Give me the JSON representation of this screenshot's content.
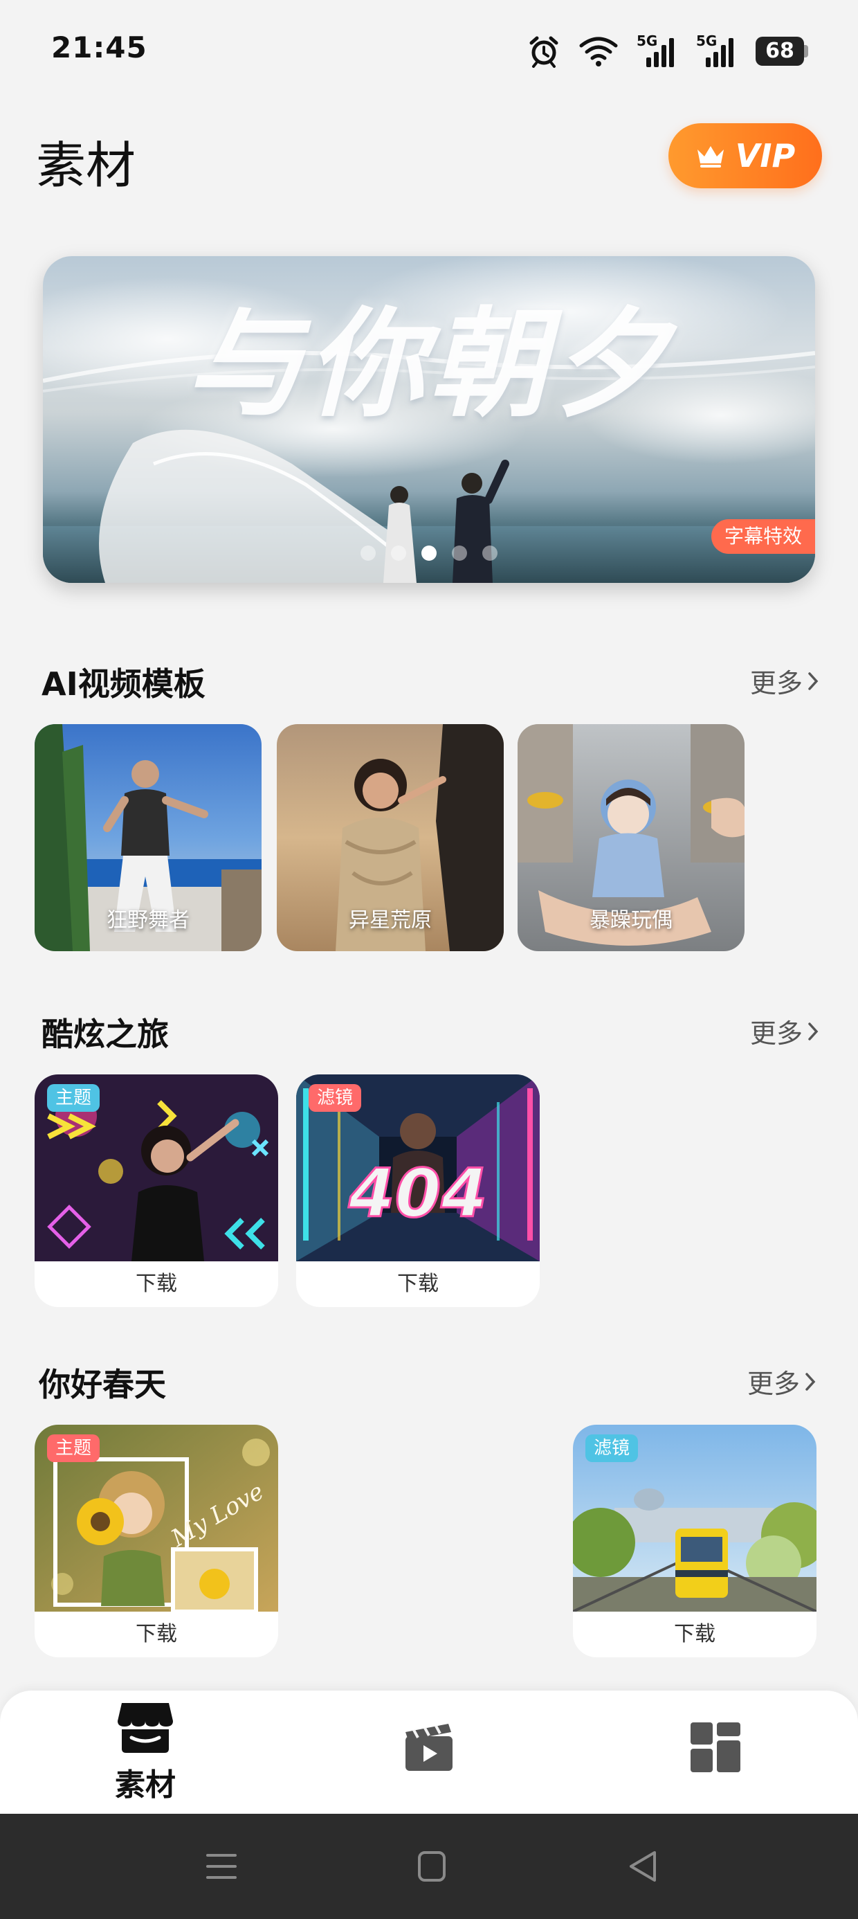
{
  "status_bar": {
    "time": "21:45",
    "signal_1": "5G",
    "signal_2": "5G",
    "battery": "68"
  },
  "header": {
    "title": "素材",
    "vip_label": "VIP"
  },
  "banner": {
    "title": "与你朝夕",
    "tag": "字幕特效",
    "slide_count": 5,
    "active_slide": 2
  },
  "sections": {
    "ai_templates": {
      "title": "AI视频模板",
      "more": "更多",
      "items": [
        {
          "label": "狂野舞者"
        },
        {
          "label": "异星荒原"
        },
        {
          "label": "暴躁玩偶"
        }
      ]
    },
    "cool_trip": {
      "title": "酷炫之旅",
      "more": "更多",
      "items": [
        {
          "badge": "主题",
          "action": "下载"
        },
        {
          "badge": "滤镜",
          "overlay_text": "404",
          "action": "下载"
        }
      ]
    },
    "hello_spring": {
      "title": "你好春天",
      "more": "更多",
      "items": [
        {
          "badge": "主题",
          "overlay_text": "My Love",
          "action": "下载"
        },
        {
          "badge": "滤镜",
          "action": "下载"
        }
      ]
    }
  },
  "bottom_nav": {
    "items": [
      {
        "label": "素材",
        "icon": "store-icon"
      },
      {
        "label": "",
        "icon": "video-icon"
      },
      {
        "label": "",
        "icon": "grid-icon"
      }
    ]
  },
  "colors": {
    "vip_gradient_start": "#ff9a2e",
    "vip_gradient_end": "#ff6f1c",
    "theme_badge": "#ff6a6a",
    "filter_badge": "#4fc3e4",
    "tag": "#ff6a4d"
  }
}
